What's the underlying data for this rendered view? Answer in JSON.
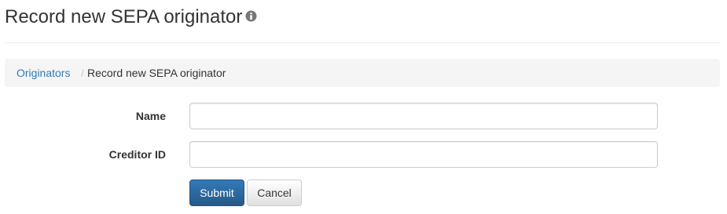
{
  "header": {
    "title": "Record new SEPA originator",
    "info_icon": "info-circle-icon"
  },
  "breadcrumb": {
    "parent_label": "Originators",
    "separator": "/",
    "current_label": "Record new SEPA originator"
  },
  "form": {
    "name_label": "Name",
    "name_value": "",
    "creditor_id_label": "Creditor ID",
    "creditor_id_value": "",
    "submit_label": "Submit",
    "cancel_label": "Cancel"
  },
  "colors": {
    "link": "#337ab7",
    "primary_button": "#2d6da3",
    "breadcrumb_background": "#f5f5f5",
    "icon": "#777777"
  }
}
